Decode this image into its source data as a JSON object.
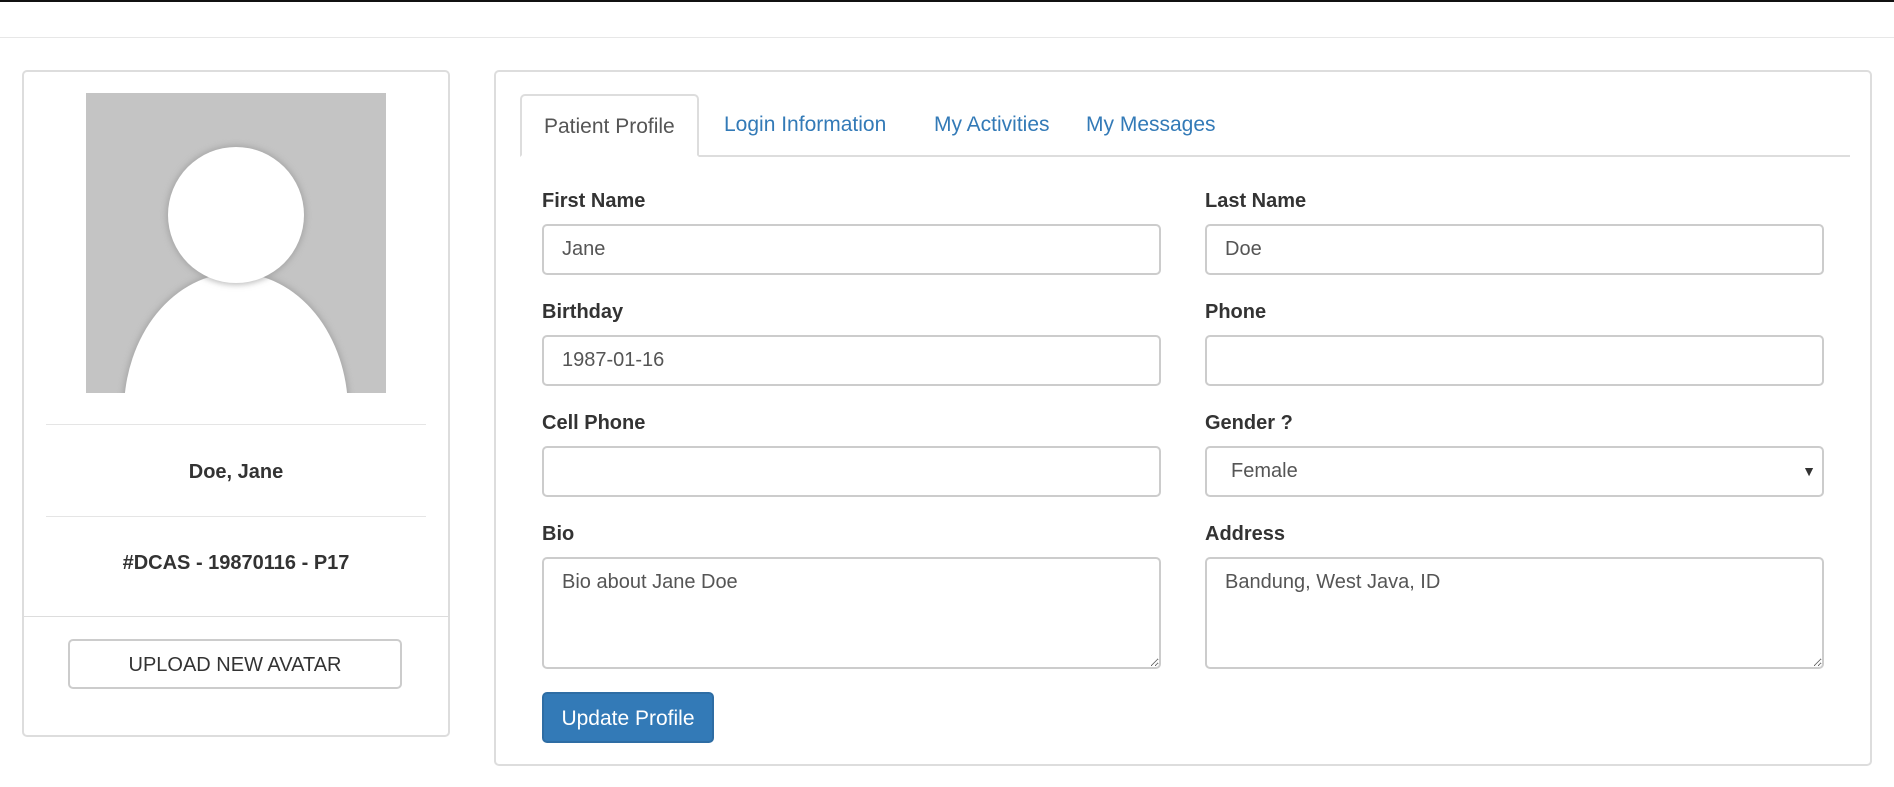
{
  "profile_card": {
    "display_name": "Doe, Jane",
    "patient_id": "#DCAS - 19870116 - P17",
    "upload_button_label": "UPLOAD NEW AVATAR"
  },
  "tabs": [
    {
      "label": "Patient Profile",
      "active": true
    },
    {
      "label": "Login Information",
      "active": false
    },
    {
      "label": "My Activities",
      "active": false
    },
    {
      "label": "My Messages",
      "active": false
    }
  ],
  "form": {
    "first_name": {
      "label": "First Name",
      "value": "Jane"
    },
    "last_name": {
      "label": "Last Name",
      "value": "Doe"
    },
    "birthday": {
      "label": "Birthday",
      "value": "1987-01-16"
    },
    "phone": {
      "label": "Phone",
      "value": ""
    },
    "cell_phone": {
      "label": "Cell Phone",
      "value": ""
    },
    "gender": {
      "label": "Gender ?",
      "value": "Female"
    },
    "bio": {
      "label": "Bio",
      "value": "Bio about Jane Doe"
    },
    "address": {
      "label": "Address",
      "value": "Bandung, West Java, ID"
    },
    "submit_label": "Update Profile"
  },
  "colors": {
    "link": "#337ab7",
    "primary_button": "#337ab7",
    "border": "#dddddd"
  },
  "icons": {
    "avatar": "default-user-silhouette",
    "select_caret": "caret-down-icon"
  }
}
